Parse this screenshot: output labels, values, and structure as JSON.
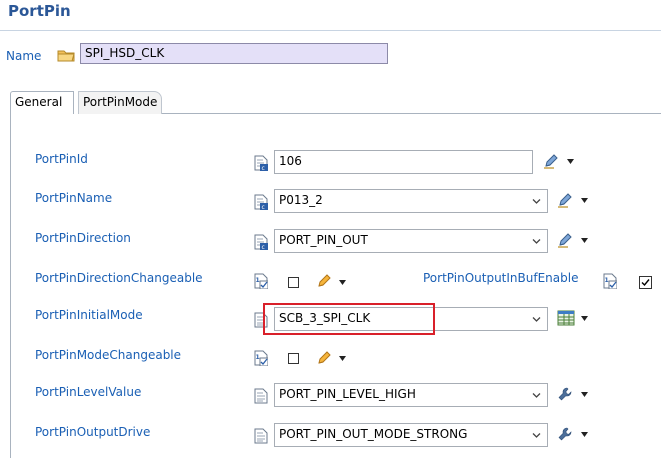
{
  "header": {
    "title": "PortPin"
  },
  "name_row": {
    "label": "Name",
    "value": "SPI_HSD_CLK"
  },
  "tabs": [
    {
      "label": "General",
      "active": true
    },
    {
      "label": "PortPinMode",
      "active": false
    }
  ],
  "fields": {
    "port_pin_id": {
      "label": "PortPinId",
      "value": "106"
    },
    "port_pin_name": {
      "label": "PortPinName",
      "value": "P013_2"
    },
    "port_pin_direction": {
      "label": "PortPinDirection",
      "value": "PORT_PIN_OUT"
    },
    "port_pin_direction_changeable": {
      "label": "PortPinDirectionChangeable",
      "checked": false
    },
    "port_pin_output_in_buf_enable": {
      "label": "PortPinOutputInBufEnable",
      "checked": true
    },
    "port_pin_initial_mode": {
      "label": "PortPinInitialMode",
      "value": "SCB_3_SPI_CLK"
    },
    "port_pin_mode_changeable": {
      "label": "PortPinModeChangeable",
      "checked": false
    },
    "port_pin_level_value": {
      "label": "PortPinLevelValue",
      "value": "PORT_PIN_LEVEL_HIGH"
    },
    "port_pin_output_drive": {
      "label": "PortPinOutputDrive",
      "value": "PORT_PIN_OUT_MODE_STRONG"
    }
  },
  "colors": {
    "label_blue": "#1a5fb4",
    "name_field_bg": "#e4e0f8",
    "highlight_red": "#d9202a"
  }
}
